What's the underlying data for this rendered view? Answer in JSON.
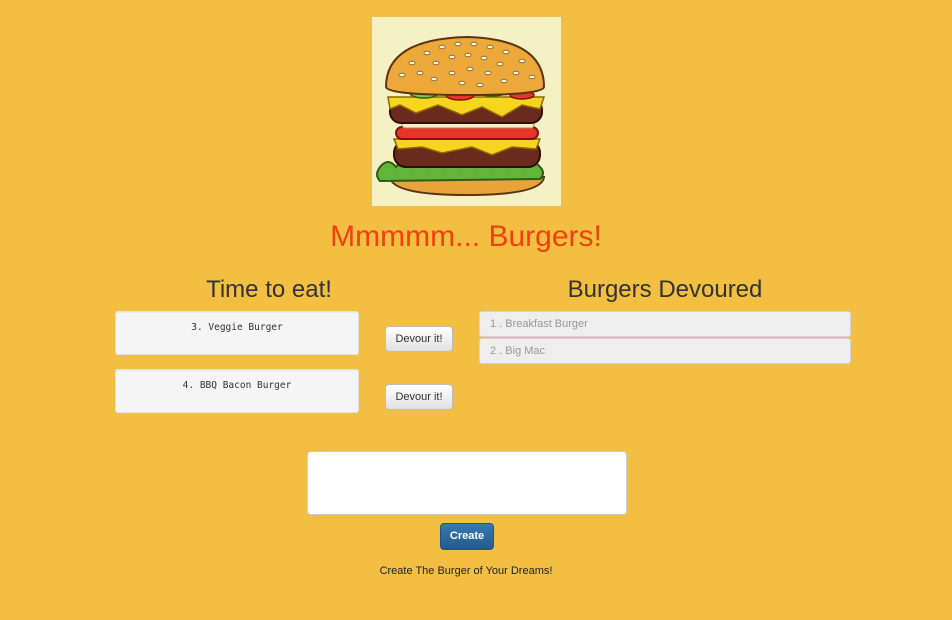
{
  "header": {
    "title": "Mmmmm... Burgers!",
    "logo_icon": "burger-icon"
  },
  "to_eat": {
    "heading": "Time to eat!",
    "devour_label": "Devour it!",
    "items": [
      {
        "label": "3. Veggie Burger"
      },
      {
        "label": "4. BBQ Bacon Burger"
      }
    ]
  },
  "devoured": {
    "heading": "Burgers Devoured",
    "items": [
      {
        "label": "1 . Breakfast Burger"
      },
      {
        "label": "2 . Big Mac"
      }
    ]
  },
  "form": {
    "input_value": "",
    "input_placeholder": "",
    "create_label": "Create",
    "tagline": "Create The Burger of Your Dreams!"
  },
  "colors": {
    "background": "#f2bf42",
    "title": "#f2400f",
    "primary_button": "#337ab7"
  }
}
